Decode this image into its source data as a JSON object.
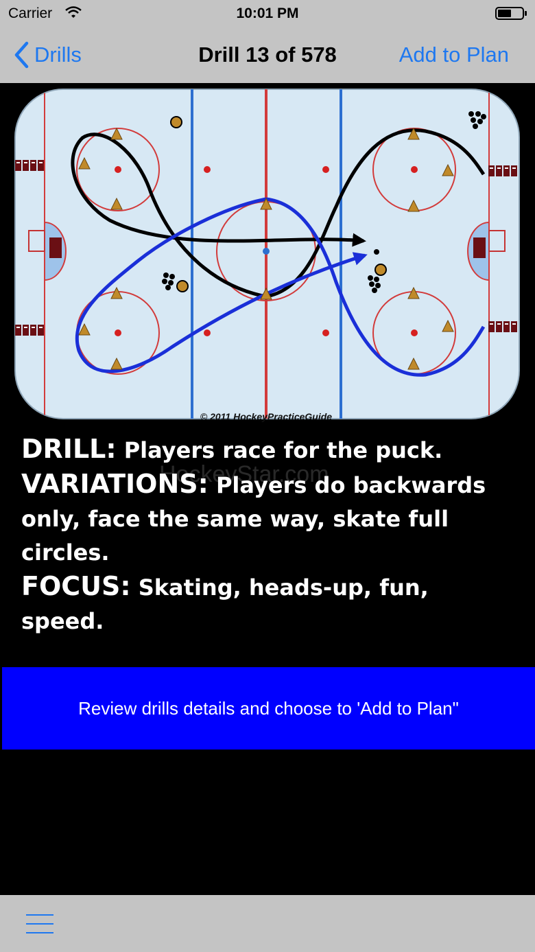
{
  "status_bar": {
    "carrier": "Carrier",
    "time": "10:01 PM"
  },
  "nav": {
    "back_label": "Drills",
    "title": "Drill 13 of 578",
    "action_label": "Add to Plan"
  },
  "diagram": {
    "copyright": "© 2011 HockeyPracticeGuide",
    "watermark": "HockeyStar.com"
  },
  "description": {
    "drill_label": "DRILL:",
    "drill_text": " Players race for the puck.",
    "variations_label": "VARIATIONS:",
    "variations_text": " Players do backwards only, face the same way, skate full circles.",
    "focus_label": "FOCUS:",
    "focus_text": " Skating, heads-up, fun, speed."
  },
  "cta": {
    "label": "Review drills details and choose to 'Add to Plan\""
  },
  "colors": {
    "accent": "#1e78f0",
    "bar_bg": "#c4c4c4",
    "cta_bg": "#0000ff",
    "route_black": "#000000",
    "route_blue": "#1a2fd8"
  }
}
